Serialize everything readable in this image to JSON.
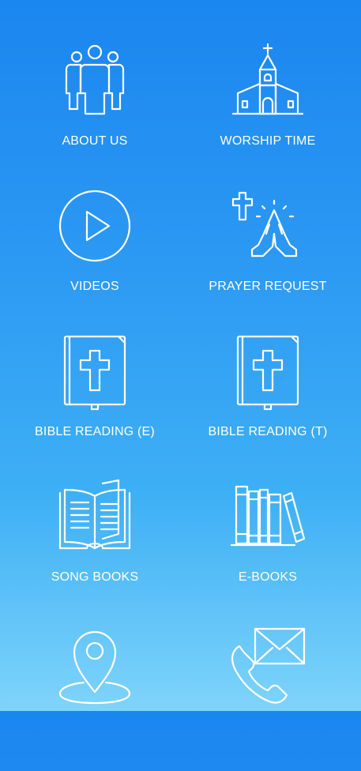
{
  "menu": {
    "items": [
      {
        "label": "ABOUT US",
        "icon": "people-group-icon"
      },
      {
        "label": "WORSHIP TIME",
        "icon": "church-icon"
      },
      {
        "label": "VIDEOS",
        "icon": "play-circle-icon"
      },
      {
        "label": "PRAYER REQUEST",
        "icon": "praying-hands-icon"
      },
      {
        "label": "BIBLE READING (E)",
        "icon": "bible-icon"
      },
      {
        "label": "BIBLE READING (T)",
        "icon": "bible-icon"
      },
      {
        "label": "SONG BOOKS",
        "icon": "open-book-icon"
      },
      {
        "label": "E-BOOKS",
        "icon": "bookshelf-icon"
      },
      {
        "label": "",
        "icon": "location-pin-icon"
      },
      {
        "label": "",
        "icon": "contact-mail-phone-icon"
      }
    ]
  },
  "colors": {
    "background_top": "#1a86f0",
    "background_bottom": "#7fd4fb",
    "icon_stroke": "#ffffff"
  }
}
